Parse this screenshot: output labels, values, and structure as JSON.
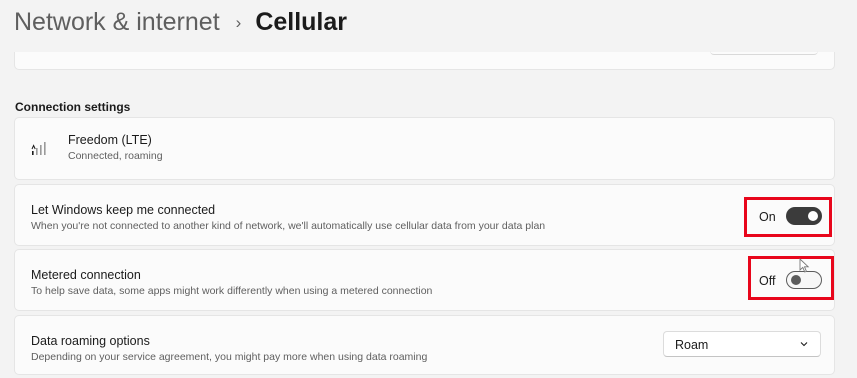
{
  "breadcrumb": {
    "parent": "Network & internet",
    "separator": "›",
    "current": "Cellular"
  },
  "connection_settings": {
    "header": "Connection settings",
    "network": {
      "icon": "cellular-signal-icon",
      "name": "Freedom (LTE)",
      "status": "Connected, roaming"
    },
    "keep_connected": {
      "title": "Let Windows keep me connected",
      "description": "When you're not connected to another kind of network, we'll automatically use cellular data from your data plan",
      "state_label": "On",
      "enabled": true
    },
    "metered": {
      "title": "Metered connection",
      "description": "To help save data, some apps might work differently when using a metered connection",
      "state_label": "Off",
      "enabled": false
    },
    "roaming": {
      "title": "Data roaming options",
      "description": "Depending on your service agreement, you might pay more when using data roaming",
      "selected": "Roam"
    }
  },
  "colors": {
    "highlight": "#e8061b",
    "toggle_on": "#3b3b3b",
    "background": "#f3f3f3",
    "card": "#fbfbfb"
  }
}
